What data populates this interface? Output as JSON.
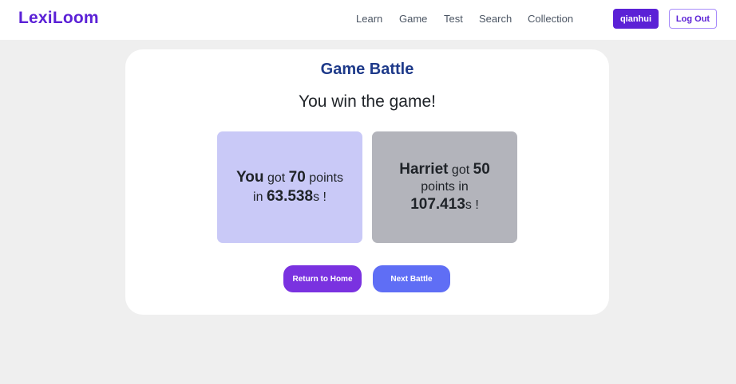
{
  "app": {
    "name": "LexiLoom"
  },
  "nav": {
    "links": [
      "Learn",
      "Game",
      "Test",
      "Search",
      "Collection"
    ],
    "user_label": "qianhui",
    "logout_label": "Log Out"
  },
  "battle": {
    "title": "Game Battle",
    "result": "You win the game!",
    "players": [
      {
        "name": "You",
        "got": "got",
        "points_value": "70",
        "points_word": "points",
        "in_word": "in",
        "time_value": "63.538",
        "time_unit": "s !"
      },
      {
        "name": "Harriet",
        "got": "got",
        "points_value": "50",
        "points_word": "points",
        "in_word": "in",
        "time_value": "107.413",
        "time_unit": "s !"
      }
    ],
    "buttons": {
      "home": "Return to Home",
      "next": "Next Battle"
    }
  },
  "colors": {
    "brand": "#5b21d6",
    "title": "#1e3a8a",
    "you_box": "#c9c9f7",
    "opponent_box": "#b3b4bb",
    "home_button": "#7a32e0",
    "next_button": "#5f6ef5"
  }
}
